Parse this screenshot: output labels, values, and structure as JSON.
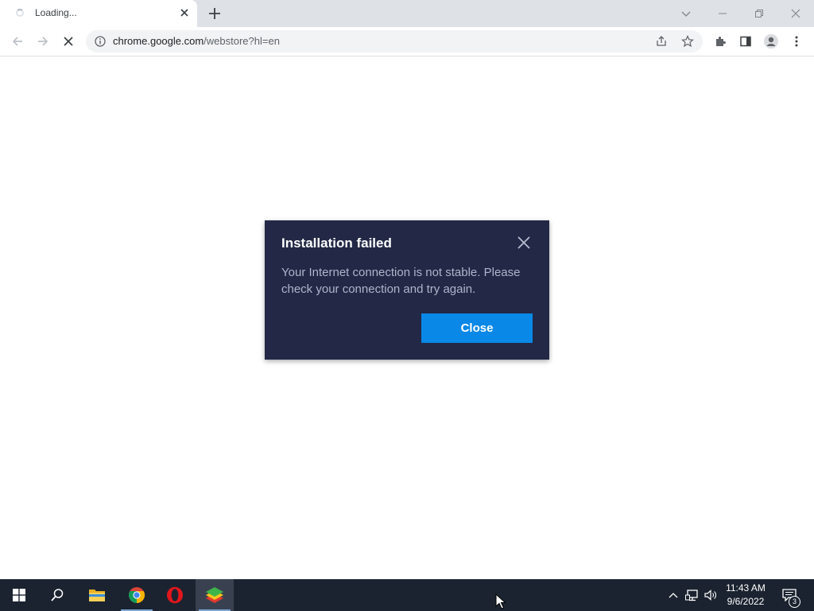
{
  "browser": {
    "tab": {
      "title": "Loading..."
    },
    "address_bar": {
      "url_host": "chrome.google.com",
      "url_path": "/webstore?hl=en"
    }
  },
  "dialog": {
    "title": "Installation failed",
    "message": "Your Internet connection is not stable. Please check your connection and try again.",
    "close_button_label": "Close",
    "colors": {
      "background": "#222845",
      "button": "#0a88e7"
    }
  },
  "taskbar": {
    "apps": [
      "windows-start",
      "search",
      "file-explorer",
      "chrome",
      "opera",
      "bluestacks"
    ],
    "clock": {
      "time": "11:43 AM",
      "date": "9/6/2022"
    },
    "notification_count": "3"
  }
}
